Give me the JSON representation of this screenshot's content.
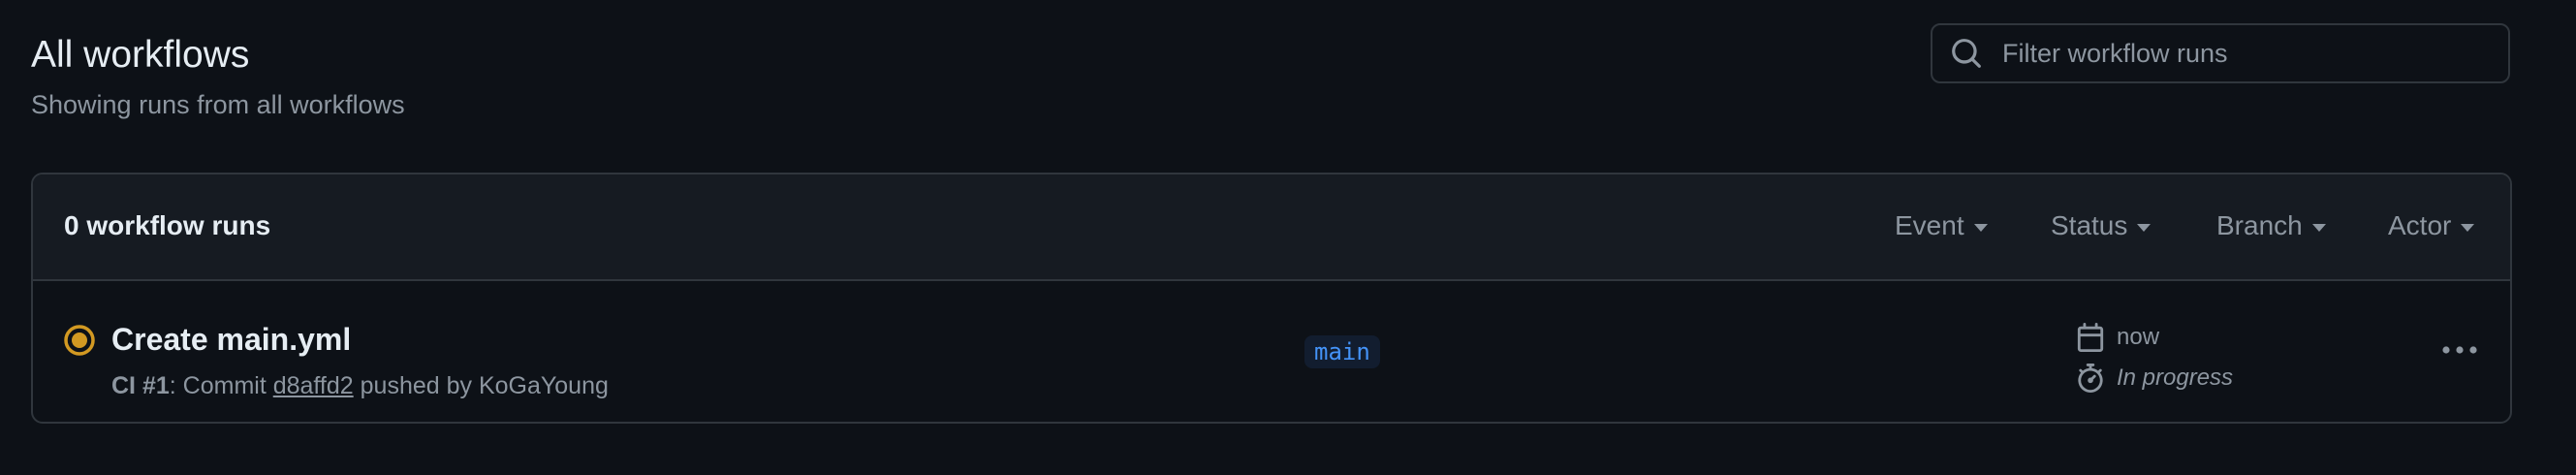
{
  "header": {
    "title": "All workflows",
    "subtitle": "Showing runs from all workflows"
  },
  "search": {
    "placeholder": "Filter workflow runs",
    "value": "",
    "icon": "search-icon"
  },
  "runs_box": {
    "count_label": "0 workflow runs",
    "filters": [
      {
        "label": "Event"
      },
      {
        "label": "Status"
      },
      {
        "label": "Branch"
      },
      {
        "label": "Actor"
      }
    ]
  },
  "runs": [
    {
      "title": "Create main.yml",
      "status_icon": "in-progress-dot-icon",
      "status_color": "#d29922",
      "workflow": "CI #1",
      "meta_prefix": ": Commit ",
      "commit": "d8affd2",
      "meta_suffix": " pushed by KoGaYoung",
      "branch": "main",
      "time": "now",
      "duration": "In progress"
    }
  ],
  "colors": {
    "background": "#0d1117",
    "header_bg": "#161b22",
    "border": "#30363d",
    "muted_text": "#8d96a0",
    "branch_text": "#4493f8",
    "branch_bg": "#121d2f"
  }
}
